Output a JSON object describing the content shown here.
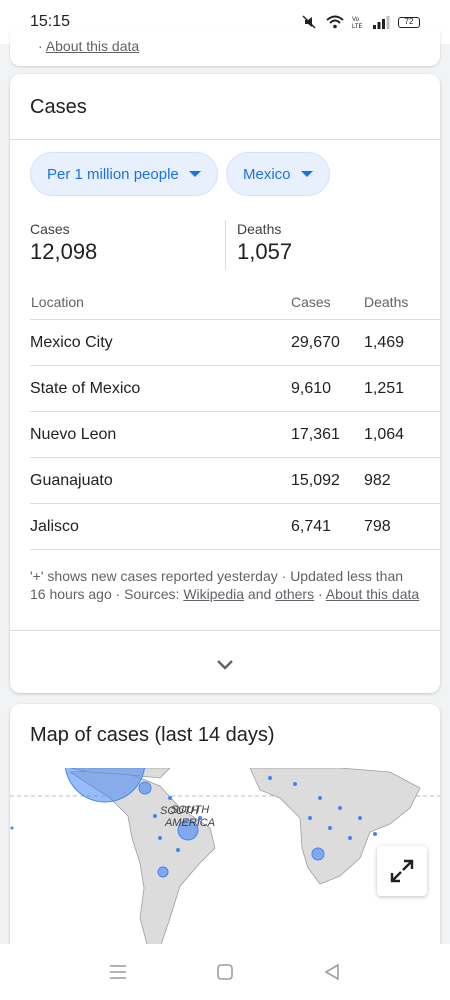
{
  "status_bar": {
    "time": "15:15",
    "battery": "72"
  },
  "prev_card": {
    "link": "About this data"
  },
  "cases_card": {
    "title": "Cases",
    "chips": [
      {
        "label": "Per 1 million people"
      },
      {
        "label": "Mexico"
      }
    ],
    "stats": {
      "cases_label": "Cases",
      "cases_value": "12,098",
      "deaths_label": "Deaths",
      "deaths_value": "1,057"
    },
    "table": {
      "headers": {
        "location": "Location",
        "cases": "Cases",
        "deaths": "Deaths"
      },
      "rows": [
        {
          "location": "Mexico City",
          "cases": "29,670",
          "deaths": "1,469"
        },
        {
          "location": "State of Mexico",
          "cases": "9,610",
          "deaths": "1,251"
        },
        {
          "location": "Nuevo Leon",
          "cases": "17,361",
          "deaths": "1,064"
        },
        {
          "location": "Guanajuato",
          "cases": "15,092",
          "deaths": "982"
        },
        {
          "location": "Jalisco",
          "cases": "6,741",
          "deaths": "798"
        }
      ]
    },
    "footnote": {
      "text_1": "'+' shows new cases reported yesterday · Updated less than 16 hours ago · Sources: ",
      "wikipedia": "Wikipedia",
      "and": " and ",
      "others": "others",
      "sep": " · ",
      "about": "About this data"
    }
  },
  "map_card": {
    "title": "Map of cases (last 14 days)",
    "label": "SOUTH AMERICA"
  },
  "colors": {
    "accent": "#1a73e8",
    "chip_bg": "#e8f0fe",
    "map_dot": "#4285f4",
    "land": "#dcdcdc"
  },
  "icons": [
    "mute-icon",
    "wifi-icon",
    "volte-icon",
    "signal-icon",
    "battery-icon",
    "chevron-down-icon",
    "fullscreen-icon",
    "menu-icon",
    "home-icon",
    "back-icon"
  ]
}
